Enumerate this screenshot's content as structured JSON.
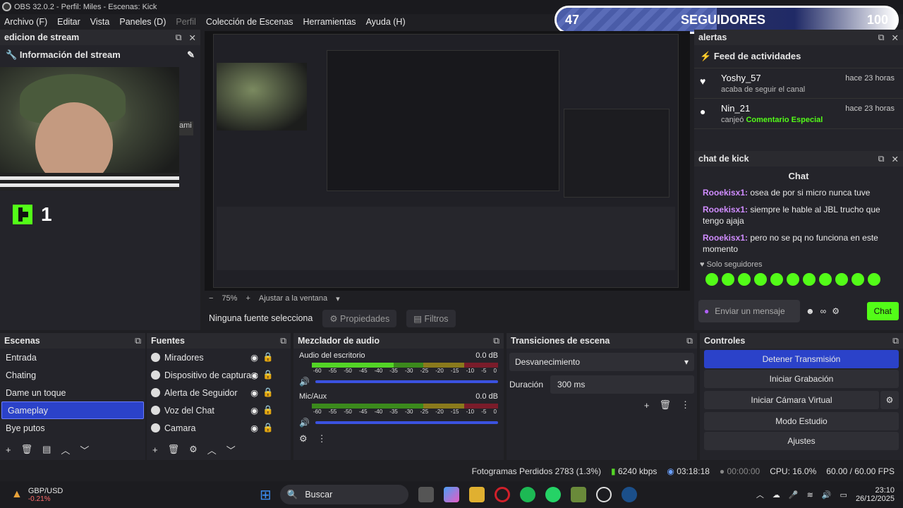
{
  "window": {
    "title": "OBS 32.0.2 - Perfil: Miles - Escenas: Kick",
    "close": "×"
  },
  "menu": [
    "Archivo (F)",
    "Editar",
    "Vista",
    "Paneles (D)",
    "Perfil",
    "Colección de Escenas",
    "Herramientas",
    "Ayuda (H)"
  ],
  "followers": {
    "current": "47",
    "label": "SEGUIDORES",
    "goal": "100",
    "progress": 0.47
  },
  "dock_stream": {
    "title": "edicion de stream",
    "info": "Información del stream",
    "kick_count": "1",
    "overlay_text": "ami"
  },
  "preview": {
    "zoom": "75%",
    "fit": "Ajustar a la ventana",
    "no_source": "Ninguna fuente selecciona",
    "properties": "Propiedades",
    "filters": "Filtros"
  },
  "alerts": {
    "title": "alertas",
    "feed_title": "Feed de actividades",
    "items": [
      {
        "name": "Yoshy_57",
        "sub": "acaba de seguir el canal",
        "time": "hace 23 horas",
        "icon": "heart-icon"
      },
      {
        "name": "Nin_21",
        "sub": "canjeó",
        "highlight": "Comentario Especial",
        "time": "hace 23 horas",
        "icon": "reward-icon"
      }
    ]
  },
  "chat": {
    "dock_title": "chat de kick",
    "heading": "Chat",
    "messages": [
      {
        "user": "Rooekisx1:",
        "text": "osea de por si micro nunca tuve"
      },
      {
        "user": "Rooekisx1:",
        "text": "siempre le hable al JBL trucho que tengo ajaja"
      },
      {
        "user": "Rooekisx1:",
        "text": "pero no se pq no funciona en este momento"
      }
    ],
    "mode": "Solo seguidores",
    "input_placeholder": "Enviar un mensaje",
    "send": "Chat"
  },
  "scenes": {
    "title": "Escenas",
    "items": [
      "Entrada",
      "Chating",
      "Dame un toque",
      "Gameplay",
      "Bye putos"
    ],
    "selected": 3
  },
  "sources": {
    "title": "Fuentes",
    "items": [
      "Miradores",
      "Dispositivo de captura c",
      "Alerta de Seguidor",
      "Voz del Chat",
      "Camara"
    ]
  },
  "mixer": {
    "title": "Mezclador de audio",
    "channels": [
      {
        "name": "Audio del escritorio",
        "db": "0.0 dB",
        "level": 0.55
      },
      {
        "name": "Mic/Aux",
        "db": "0.0 dB",
        "level": 0.48
      }
    ],
    "scale": [
      "-60",
      "-55",
      "-50",
      "-45",
      "-40",
      "-35",
      "-30",
      "-25",
      "-20",
      "-15",
      "-10",
      "-5",
      "0"
    ]
  },
  "transitions": {
    "title": "Transiciones de escena",
    "type": "Desvanecimiento",
    "duration_label": "Duración",
    "duration": "300 ms"
  },
  "controls": {
    "title": "Controles",
    "buttons": [
      "Detener Transmisión",
      "Iniciar Grabación",
      "Iniciar Cámara Virtual",
      "Modo Estudio",
      "Ajustes"
    ]
  },
  "status": {
    "frames": "Fotogramas Perdidos 2783 (1.3%)",
    "kbps": "6240 kbps",
    "live": "03:18:18",
    "rec": "00:00:00",
    "cpu": "CPU: 16.0%",
    "fps": "60.00 / 60.00 FPS"
  },
  "taskbar": {
    "ticker": "GBP/USD",
    "change": "-0.21%",
    "search": "Buscar",
    "time": "23:10",
    "date": "26/12/2025"
  },
  "colors": {
    "accent": "#2b42c9",
    "kick": "#53fc18"
  }
}
